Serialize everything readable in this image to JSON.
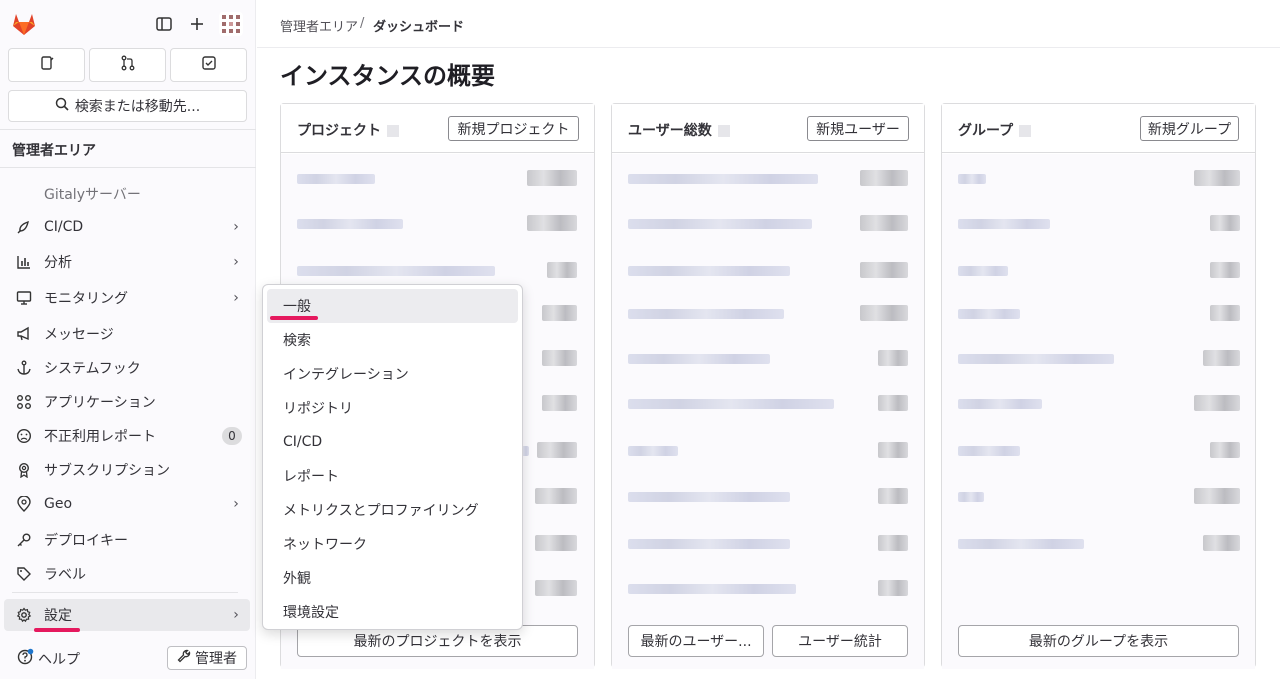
{
  "sidebar": {
    "search_label": "検索または移動先...",
    "section_title": "管理者エリア",
    "gitaly_label": "Gitalyサーバー",
    "items": [
      {
        "label": "CI/CD",
        "icon": "rocket-icon",
        "chevron": true
      },
      {
        "label": "分析",
        "icon": "chart-icon",
        "chevron": true
      },
      {
        "label": "モニタリング",
        "icon": "monitor-icon",
        "chevron": true
      },
      {
        "label": "メッセージ",
        "icon": "bullhorn-icon",
        "chevron": false
      },
      {
        "label": "システムフック",
        "icon": "anchor-icon",
        "chevron": false
      },
      {
        "label": "アプリケーション",
        "icon": "apps-icon",
        "chevron": false
      },
      {
        "label": "不正利用レポート",
        "icon": "abuse-icon",
        "chevron": false,
        "badge": "0"
      },
      {
        "label": "サブスクリプション",
        "icon": "ribbon-icon",
        "chevron": false
      },
      {
        "label": "Geo",
        "icon": "location-icon",
        "chevron": true
      },
      {
        "label": "デプロイキー",
        "icon": "key-icon",
        "chevron": false
      },
      {
        "label": "ラベル",
        "icon": "label-icon",
        "chevron": false
      }
    ],
    "settings_label": "設定",
    "help_label": "ヘルプ",
    "admin_label": "管理者"
  },
  "breadcrumb": {
    "parent": "管理者エリア",
    "separator": "/",
    "current": "ダッシュボード"
  },
  "page_title": "インスタンスの概要",
  "cards": [
    {
      "title": "プロジェクト",
      "header_button": "新規プロジェクト",
      "footer_buttons": [
        "最新のプロジェクトを表示"
      ]
    },
    {
      "title": "ユーザー総数",
      "header_button": "新規ユーザー",
      "footer_buttons": [
        "最新のユーザー...",
        "ユーザー統計"
      ]
    },
    {
      "title": "グループ",
      "header_button": "新規グループ",
      "footer_buttons": [
        "最新のグループを表示"
      ]
    }
  ],
  "settings_menu": [
    "一般",
    "検索",
    "インテグレーション",
    "リポジトリ",
    "CI/CD",
    "レポート",
    "メトリクスとプロファイリング",
    "ネットワーク",
    "外観",
    "環境設定"
  ],
  "colors": {
    "accent": "#e5195e",
    "logo": "#e24329"
  }
}
